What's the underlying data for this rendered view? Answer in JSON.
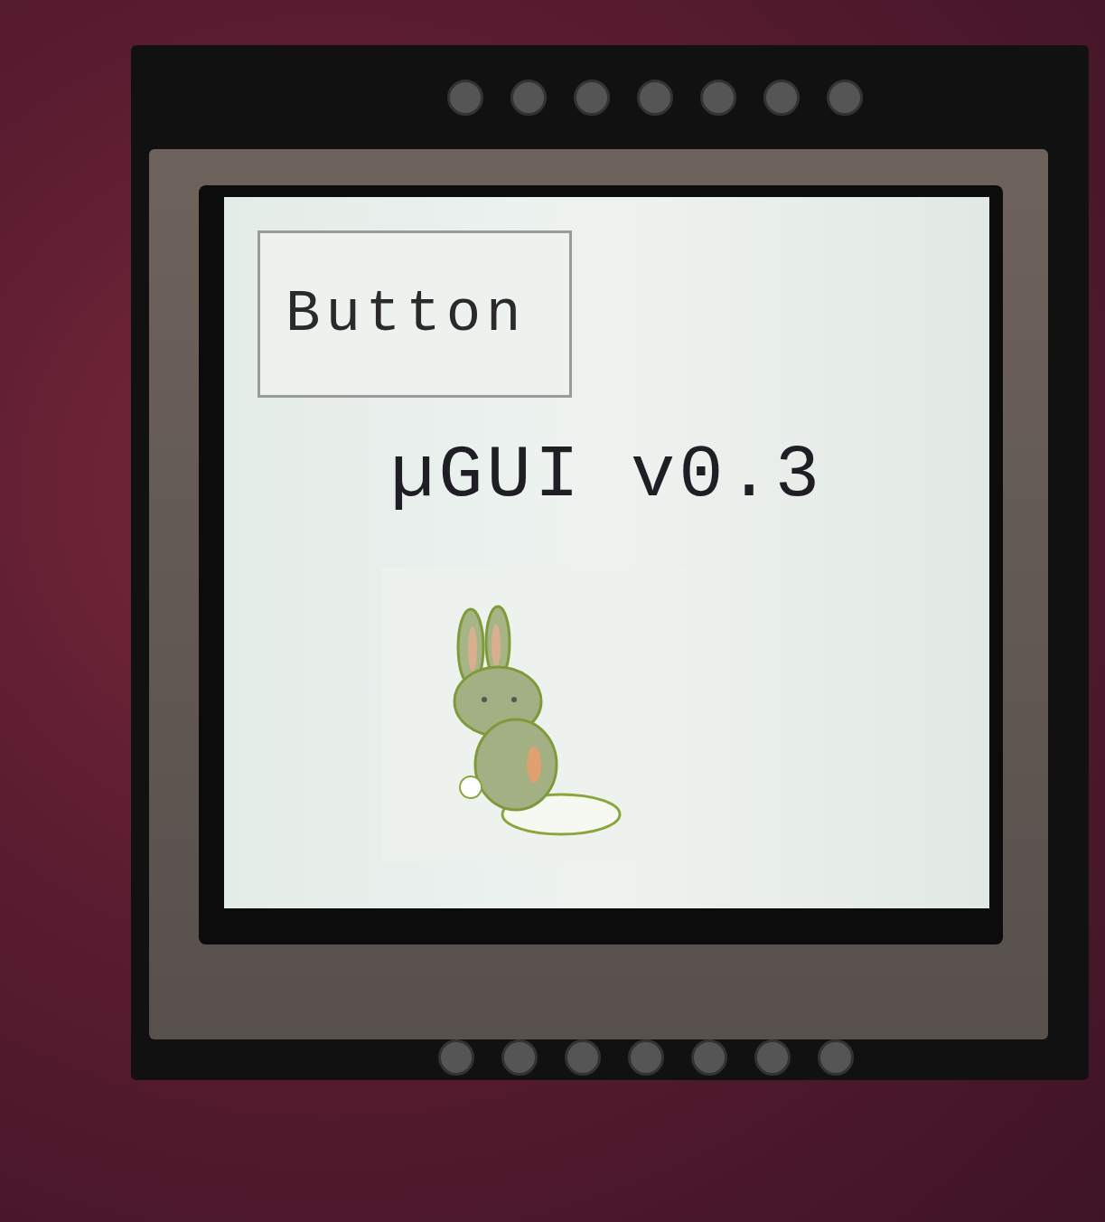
{
  "button": {
    "label": "Button"
  },
  "title": "µGUI v0.3"
}
